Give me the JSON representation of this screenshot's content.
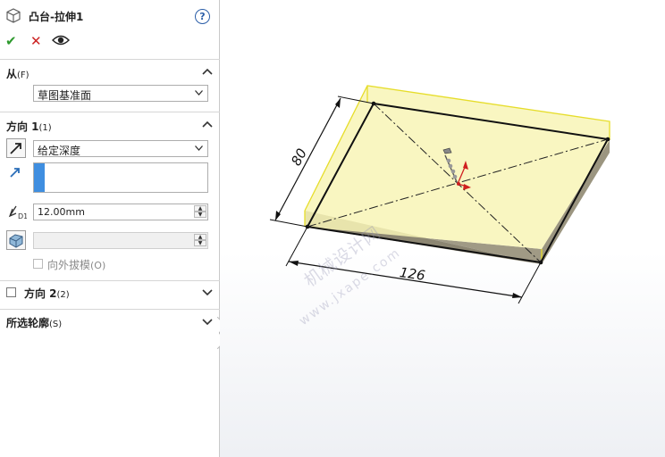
{
  "panel": {
    "title": "凸台-拉伸1",
    "help_label": "?",
    "actions": {
      "ok": "✔",
      "cancel": "✕"
    }
  },
  "from_section": {
    "title": "从",
    "mnemonic": "(F)",
    "start_condition": "草图基准面"
  },
  "direction1": {
    "title": "方向 1",
    "mnemonic": "(1)",
    "end_condition": "给定深度",
    "depth": "12.00mm",
    "draft_outward_label": "向外拔模",
    "draft_outward_mnemonic": "(O)"
  },
  "direction2": {
    "title": "方向 2",
    "mnemonic": "(2)"
  },
  "selected_contours": {
    "title": "所选轮廓",
    "mnemonic": "(S)"
  },
  "viewport": {
    "dim_width": "126",
    "dim_depth": "80",
    "watermark_cn": "机械设计网",
    "watermark_url": "www.jxape.com",
    "preview_fill": "#f7f3b0",
    "edge_color": "#e6dd2a"
  }
}
